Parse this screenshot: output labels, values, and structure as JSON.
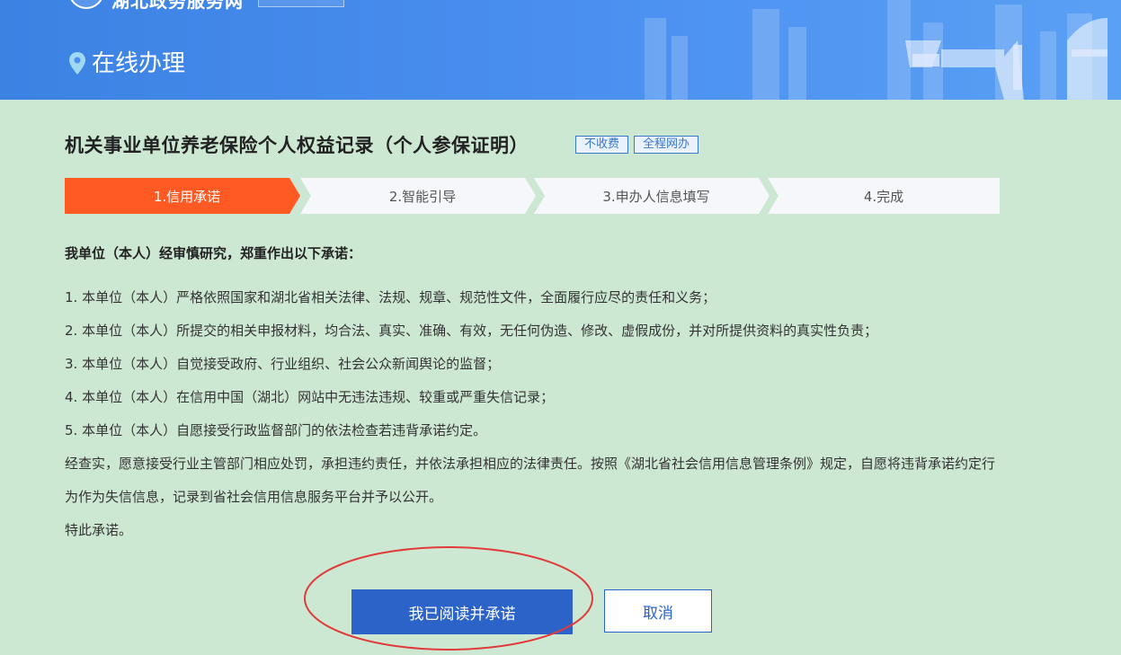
{
  "header": {
    "site_name": "湖北政务服务网",
    "section_title": "在线办理"
  },
  "title": {
    "text": "机关事业单位养老保险个人权益记录（个人参保证明）",
    "tags": [
      "不收费",
      "全程网办"
    ]
  },
  "steps": [
    {
      "label": "1.信用承诺",
      "active": true
    },
    {
      "label": "2.智能引导",
      "active": false
    },
    {
      "label": "3.申办人信息填写",
      "active": false
    },
    {
      "label": "4.完成",
      "active": false
    }
  ],
  "colors": {
    "active_step": "#ff5a24",
    "inactive_step": "#f5f7fa",
    "primary": "#2b63c9",
    "background": "#cde8d2",
    "highlight_ellipse": "#e03a3a"
  },
  "commitment": {
    "heading": "我单位（本人）经审慎研究，郑重作出以下承诺：",
    "items": [
      "1. 本单位（本人）严格依照国家和湖北省相关法律、法规、规章、规范性文件，全面履行应尽的责任和义务；",
      "2. 本单位（本人）所提交的相关申报材料，均合法、真实、准确、有效，无任何伪造、修改、虚假成份，并对所提供资料的真实性负责；",
      "3. 本单位（本人）自觉接受政府、行业组织、社会公众新闻舆论的监督；",
      "4. 本单位（本人）在信用中国（湖北）网站中无违法违规、较重或严重失信记录；",
      "5. 本单位（本人）自愿接受行政监督部门的依法检查若违背承诺约定。"
    ],
    "paragraph": "经查实，愿意接受行业主管部门相应处罚，承担违约责任，并依法承担相应的法律责任。按照《湖北省社会信用信息管理条例》规定，自愿将违背承诺约定行为作为失信信息，记录到省社会信用信息服务平台并予以公开。",
    "closing": "特此承诺。"
  },
  "buttons": {
    "agree": "我已阅读并承诺",
    "cancel": "取消"
  }
}
